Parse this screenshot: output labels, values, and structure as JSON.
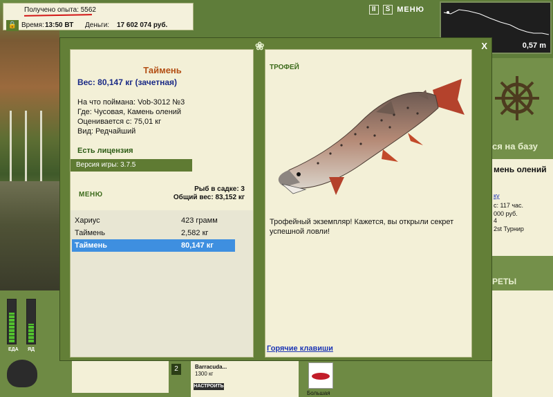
{
  "hud": {
    "experience_text": "Получено опыта: 5562",
    "time_label": "Время:",
    "time_value": "13:50 ВТ",
    "money_label": "Деньги:",
    "money_value": "17 602 074 руб.",
    "pause_label": "II",
    "s_label": "S",
    "menu_label": "МЕНЮ",
    "depth": "0,57 m"
  },
  "right_panel": {
    "base_button": "ся на базу",
    "location_fragment": "мень олений",
    "link_fragment": "ку",
    "hours": "с: 117 час.",
    "money_fragment": "000 руб.",
    "digit": "4",
    "tournament": "2st Турнир",
    "secrets_button": "РЕТЫ"
  },
  "bottom": {
    "gauge_left_label": "ЕДА",
    "gauge_right_label": "ЯД",
    "gauge_left_level": 0.72,
    "gauge_right_level": 0.45,
    "slot_number": "2",
    "gear_name": "Barracuda...",
    "gear_value": "1300 кг",
    "tune_button": "НАСТРОИТЬ",
    "lure_label": "Большая"
  },
  "modal": {
    "close_label": "X",
    "fish_name": "Таймень",
    "fish_weight": "Вес: 80,147 кг (зачетная)",
    "info_lines": [
      "На что поймана: Vob-3012 №3",
      "Где: Чусовая, Камень олений",
      "Оценивается с: 75,01 кг",
      "Вид: Редчайший"
    ],
    "license": "Есть лицензия",
    "version": "Версия игры: 3.7.5",
    "menu_label": "МЕНЮ",
    "keep_count": "Рыб в садке: 3",
    "keep_weight": "Общий вес: 83,152 кг",
    "catches": [
      {
        "name": "Хариус",
        "weight": "423 грамм",
        "selected": false
      },
      {
        "name": "Таймень",
        "weight": "2,582 кг",
        "selected": false
      },
      {
        "name": "Таймень",
        "weight": "80,147 кг",
        "selected": true
      }
    ],
    "trophy_label": "ТРОФЕЙ",
    "trophy_text": "Трофейный экземпляр! Кажется, вы открыли секрет успешной ловли!",
    "hotkeys_link": "Горячие клавиши"
  }
}
